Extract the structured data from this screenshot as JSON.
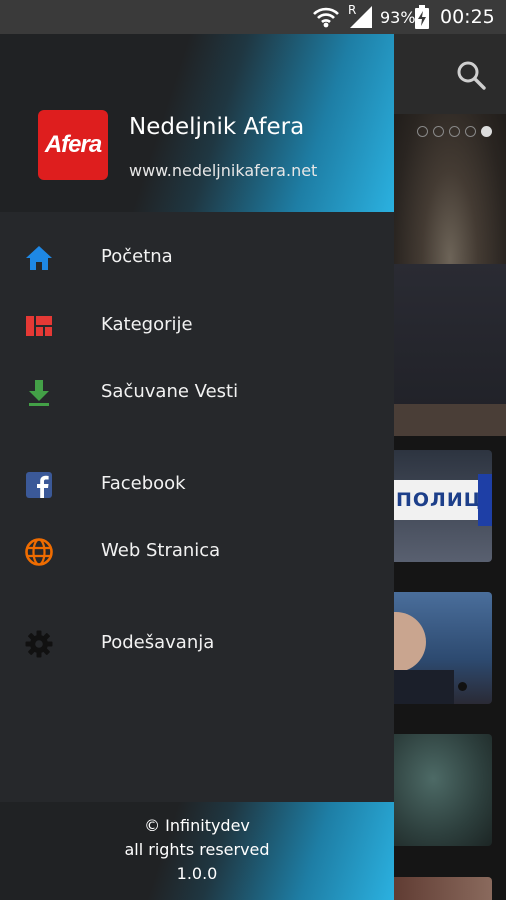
{
  "status_bar": {
    "signal_label": "R",
    "battery_percent": "93%",
    "time": "00:25",
    "icons": [
      "wifi-icon",
      "cell-signal-icon",
      "battery-charging-icon"
    ]
  },
  "app": {
    "search_icon": "search-icon",
    "carousel": {
      "count": 5,
      "active_index": 4
    }
  },
  "card_texts": {
    "police": "ПОЛИЦИЈА"
  },
  "drawer": {
    "brand": {
      "logo_text": "Afera",
      "logo_color": "#de1e1e"
    },
    "title": "Nedeljnik Afera",
    "url": "www.nedeljnikafera.net",
    "menu": [
      {
        "label": "Početna",
        "icon": "home-icon",
        "color": "#1e88e5"
      },
      {
        "label": "Kategorije",
        "icon": "categories-icon",
        "color": "#e53935"
      },
      {
        "label": "Sačuvane Vesti",
        "icon": "download-icon",
        "color": "#43a047"
      },
      {
        "label": "Facebook",
        "icon": "facebook-icon",
        "color": "#3b5998"
      },
      {
        "label": "Web Stranica",
        "icon": "globe-icon",
        "color": "#ef6c00"
      },
      {
        "label": "Podešavanja",
        "icon": "settings-icon",
        "color": "#111111"
      }
    ],
    "footer": {
      "copyright": "© Infinitydev",
      "rights": "all rights reserved",
      "version": "1.0.0"
    }
  }
}
